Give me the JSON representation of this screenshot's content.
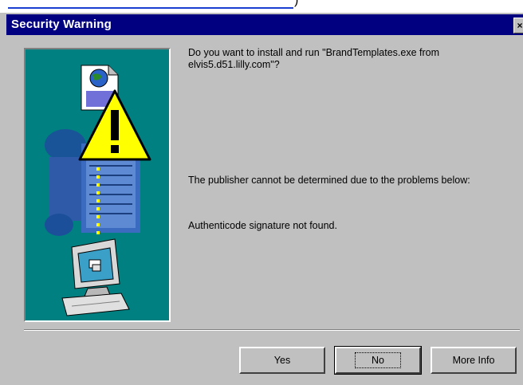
{
  "window": {
    "title": "Security Warning",
    "close_glyph": "×"
  },
  "top_fragment": {
    "paren": ")"
  },
  "message": {
    "question": "Do you want to install and run \"BrandTemplates.exe from elvis5.d51.lilly.com\"?",
    "publisher": "The publisher cannot be determined due to the problems below:",
    "detail": "Authenticode signature not found."
  },
  "buttons": {
    "yes": "Yes",
    "no": "No",
    "more_info": "More Info"
  },
  "colors": {
    "titlebar": "#000080",
    "dialog": "#c0c0c0",
    "picture_bg": "#008080",
    "warning_yellow": "#ffff00"
  },
  "icons": [
    "warning-icon",
    "document-icon",
    "globe-icon",
    "certificate-icon",
    "computer-icon",
    "close-icon"
  ]
}
